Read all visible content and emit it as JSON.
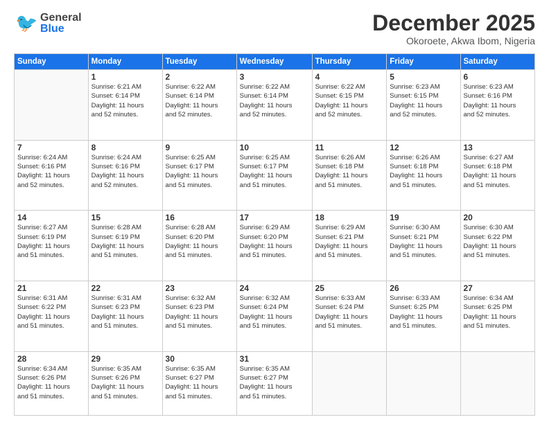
{
  "header": {
    "logo_general": "General",
    "logo_blue": "Blue",
    "month_title": "December 2025",
    "subtitle": "Okoroete, Akwa Ibom, Nigeria"
  },
  "days_of_week": [
    "Sunday",
    "Monday",
    "Tuesday",
    "Wednesday",
    "Thursday",
    "Friday",
    "Saturday"
  ],
  "weeks": [
    [
      {
        "day": "",
        "info": ""
      },
      {
        "day": "1",
        "info": "Sunrise: 6:21 AM\nSunset: 6:14 PM\nDaylight: 11 hours\nand 52 minutes."
      },
      {
        "day": "2",
        "info": "Sunrise: 6:22 AM\nSunset: 6:14 PM\nDaylight: 11 hours\nand 52 minutes."
      },
      {
        "day": "3",
        "info": "Sunrise: 6:22 AM\nSunset: 6:14 PM\nDaylight: 11 hours\nand 52 minutes."
      },
      {
        "day": "4",
        "info": "Sunrise: 6:22 AM\nSunset: 6:15 PM\nDaylight: 11 hours\nand 52 minutes."
      },
      {
        "day": "5",
        "info": "Sunrise: 6:23 AM\nSunset: 6:15 PM\nDaylight: 11 hours\nand 52 minutes."
      },
      {
        "day": "6",
        "info": "Sunrise: 6:23 AM\nSunset: 6:16 PM\nDaylight: 11 hours\nand 52 minutes."
      }
    ],
    [
      {
        "day": "7",
        "info": "Sunrise: 6:24 AM\nSunset: 6:16 PM\nDaylight: 11 hours\nand 52 minutes."
      },
      {
        "day": "8",
        "info": "Sunrise: 6:24 AM\nSunset: 6:16 PM\nDaylight: 11 hours\nand 52 minutes."
      },
      {
        "day": "9",
        "info": "Sunrise: 6:25 AM\nSunset: 6:17 PM\nDaylight: 11 hours\nand 51 minutes."
      },
      {
        "day": "10",
        "info": "Sunrise: 6:25 AM\nSunset: 6:17 PM\nDaylight: 11 hours\nand 51 minutes."
      },
      {
        "day": "11",
        "info": "Sunrise: 6:26 AM\nSunset: 6:18 PM\nDaylight: 11 hours\nand 51 minutes."
      },
      {
        "day": "12",
        "info": "Sunrise: 6:26 AM\nSunset: 6:18 PM\nDaylight: 11 hours\nand 51 minutes."
      },
      {
        "day": "13",
        "info": "Sunrise: 6:27 AM\nSunset: 6:18 PM\nDaylight: 11 hours\nand 51 minutes."
      }
    ],
    [
      {
        "day": "14",
        "info": "Sunrise: 6:27 AM\nSunset: 6:19 PM\nDaylight: 11 hours\nand 51 minutes."
      },
      {
        "day": "15",
        "info": "Sunrise: 6:28 AM\nSunset: 6:19 PM\nDaylight: 11 hours\nand 51 minutes."
      },
      {
        "day": "16",
        "info": "Sunrise: 6:28 AM\nSunset: 6:20 PM\nDaylight: 11 hours\nand 51 minutes."
      },
      {
        "day": "17",
        "info": "Sunrise: 6:29 AM\nSunset: 6:20 PM\nDaylight: 11 hours\nand 51 minutes."
      },
      {
        "day": "18",
        "info": "Sunrise: 6:29 AM\nSunset: 6:21 PM\nDaylight: 11 hours\nand 51 minutes."
      },
      {
        "day": "19",
        "info": "Sunrise: 6:30 AM\nSunset: 6:21 PM\nDaylight: 11 hours\nand 51 minutes."
      },
      {
        "day": "20",
        "info": "Sunrise: 6:30 AM\nSunset: 6:22 PM\nDaylight: 11 hours\nand 51 minutes."
      }
    ],
    [
      {
        "day": "21",
        "info": "Sunrise: 6:31 AM\nSunset: 6:22 PM\nDaylight: 11 hours\nand 51 minutes."
      },
      {
        "day": "22",
        "info": "Sunrise: 6:31 AM\nSunset: 6:23 PM\nDaylight: 11 hours\nand 51 minutes."
      },
      {
        "day": "23",
        "info": "Sunrise: 6:32 AM\nSunset: 6:23 PM\nDaylight: 11 hours\nand 51 minutes."
      },
      {
        "day": "24",
        "info": "Sunrise: 6:32 AM\nSunset: 6:24 PM\nDaylight: 11 hours\nand 51 minutes."
      },
      {
        "day": "25",
        "info": "Sunrise: 6:33 AM\nSunset: 6:24 PM\nDaylight: 11 hours\nand 51 minutes."
      },
      {
        "day": "26",
        "info": "Sunrise: 6:33 AM\nSunset: 6:25 PM\nDaylight: 11 hours\nand 51 minutes."
      },
      {
        "day": "27",
        "info": "Sunrise: 6:34 AM\nSunset: 6:25 PM\nDaylight: 11 hours\nand 51 minutes."
      }
    ],
    [
      {
        "day": "28",
        "info": "Sunrise: 6:34 AM\nSunset: 6:26 PM\nDaylight: 11 hours\nand 51 minutes."
      },
      {
        "day": "29",
        "info": "Sunrise: 6:35 AM\nSunset: 6:26 PM\nDaylight: 11 hours\nand 51 minutes."
      },
      {
        "day": "30",
        "info": "Sunrise: 6:35 AM\nSunset: 6:27 PM\nDaylight: 11 hours\nand 51 minutes."
      },
      {
        "day": "31",
        "info": "Sunrise: 6:35 AM\nSunset: 6:27 PM\nDaylight: 11 hours\nand 51 minutes."
      },
      {
        "day": "",
        "info": ""
      },
      {
        "day": "",
        "info": ""
      },
      {
        "day": "",
        "info": ""
      }
    ]
  ]
}
